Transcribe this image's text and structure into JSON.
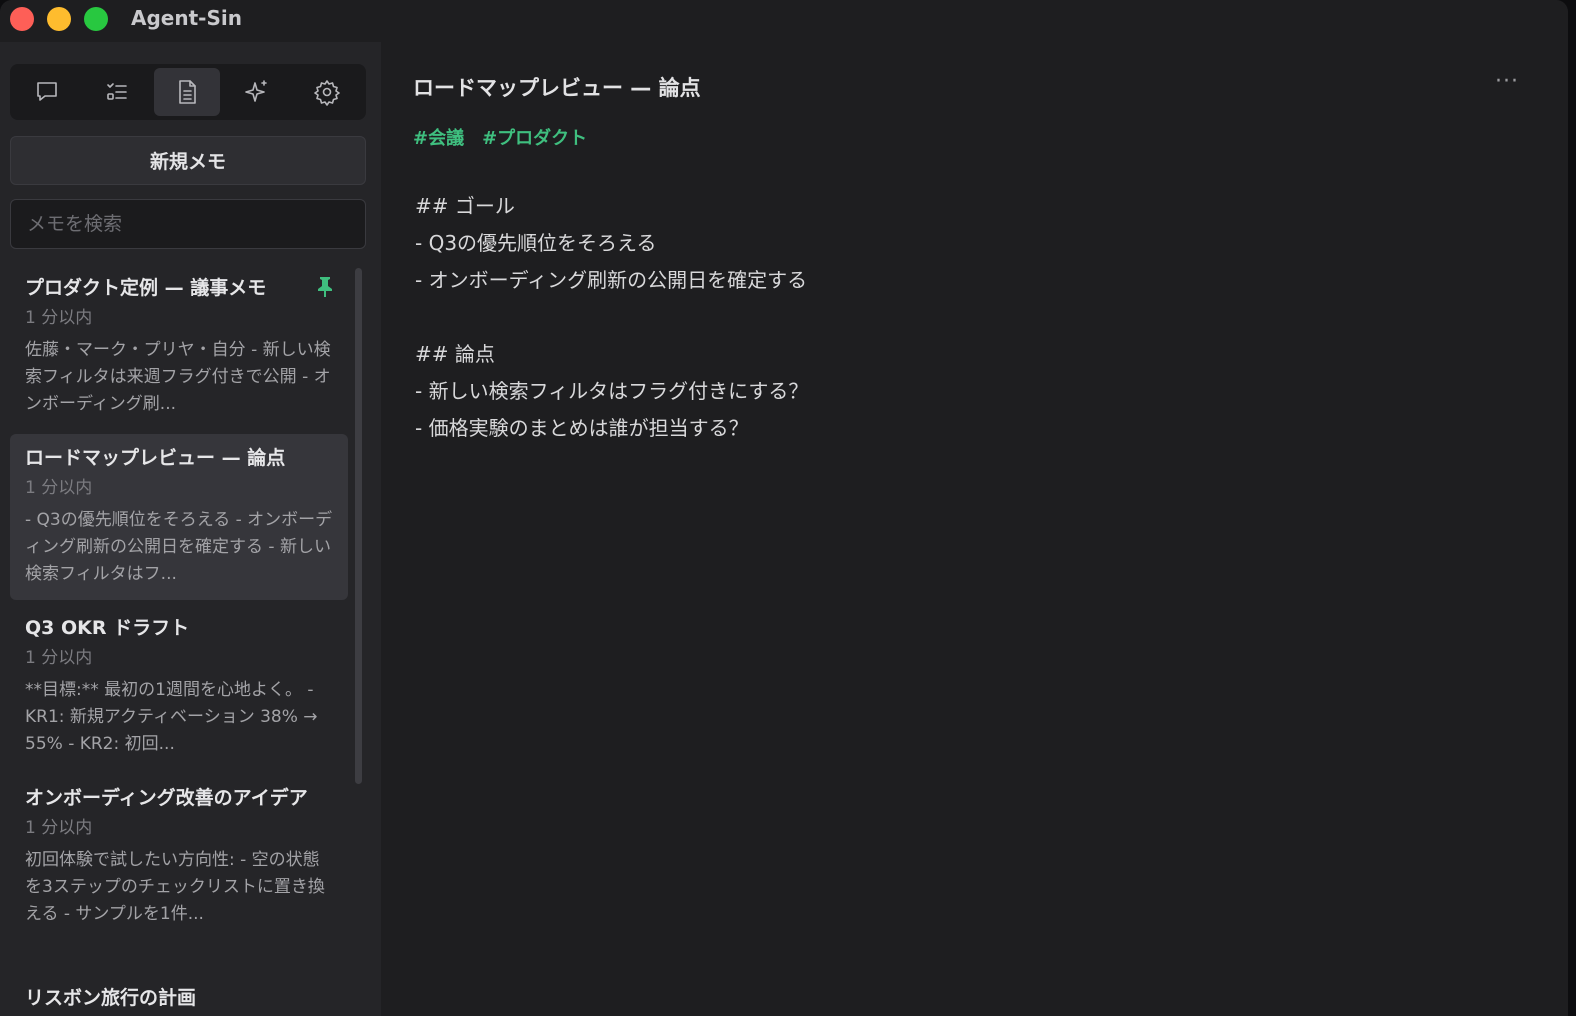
{
  "window": {
    "title": "Agent-Sin"
  },
  "toolbar": {
    "tools": [
      "chat-icon",
      "tasks-icon",
      "document-icon",
      "sparkle-icon",
      "gear-icon"
    ],
    "active": "document-icon"
  },
  "sidebar": {
    "new_memo_label": "新規メモ",
    "search_placeholder": "メモを検索",
    "memos": [
      {
        "title": "プロダクト定例 — 議事メモ",
        "time": "1 分以内",
        "snippet": "佐藤・マーク・プリヤ・自分 - 新しい検索フィルタは来週フラグ付きで公開 - オンボーディング刷...",
        "pinned": true
      },
      {
        "title": "ロードマップレビュー — 論点",
        "time": "1 分以内",
        "snippet": "- Q3の優先順位をそろえる - オンボーディング刷新の公開日を確定する - 新しい検索フィルタはフ...",
        "selected": true
      },
      {
        "title": "Q3 OKR ドラフト",
        "time": "1 分以内",
        "snippet": "**目標:** 最初の1週間を心地よく。 - KR1: 新規アクティベーション 38% → 55% - KR2: 初回..."
      },
      {
        "title": "オンボーディング改善のアイデア",
        "time": "1 分以内",
        "snippet": "初回体験で試したい方向性: - 空の状態を3ステップのチェックリストに置き換える - サンプルを1件..."
      },
      {
        "title": "リスボン旅行の計画"
      }
    ]
  },
  "note": {
    "title": "ロードマップレビュー — 論点",
    "more_label": "···",
    "tags": [
      "#会議",
      "#プロダクト"
    ],
    "lines": [
      "## ゴール",
      "- Q3の優先順位をそろえる",
      "- オンボーディング刷新の公開日を確定する",
      "",
      "## 論点",
      "- 新しい検索フィルタはフラグ付きにする？",
      "- 価格実験のまとめは誰が担当する？"
    ]
  },
  "colors": {
    "background": "#1e1e20",
    "sidebar": "#252528",
    "accent": "#3fbf7f",
    "selected": "#36363b"
  }
}
